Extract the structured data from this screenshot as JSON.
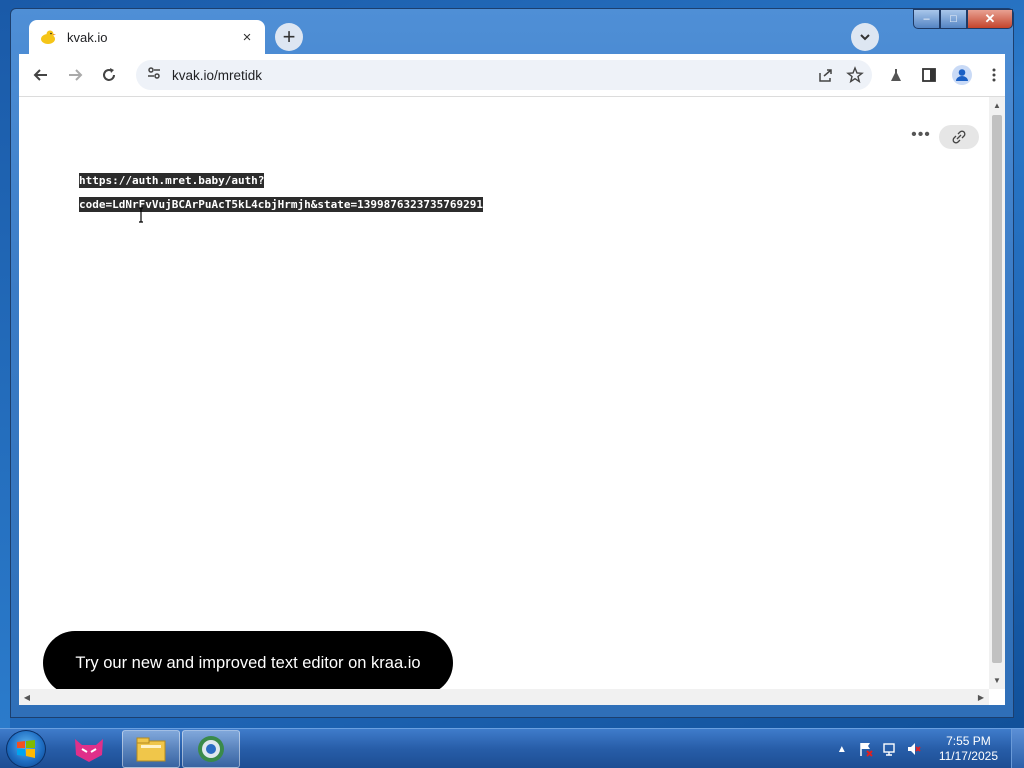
{
  "browser": {
    "tab": {
      "title": "kvak.io",
      "favicon": "duck-icon",
      "close_label": "×"
    },
    "new_tab_label": "+",
    "address": {
      "url": "kvak.io/mretidk"
    },
    "window_controls": {
      "minimize": "–",
      "maximize": "□",
      "close": "✕"
    }
  },
  "page": {
    "text_lines": [
      "https://auth.mret.baby/auth?",
      "code=LdNrFvVujBCArPuAcT5kL4cbjHrmjh&state=1399876323735769291"
    ],
    "more_label": "•••",
    "banner_text": "Try our new and improved text editor on kraa.io"
  },
  "taskbar": {
    "apps": [
      "cat-app-icon",
      "file-explorer-icon",
      "browser-icon"
    ],
    "clock_time": "7:55 PM",
    "clock_date": "11/17/2025"
  },
  "colors": {
    "selection": "#2c2c2c",
    "banner": "#000000",
    "taskbar": "#275da8"
  }
}
